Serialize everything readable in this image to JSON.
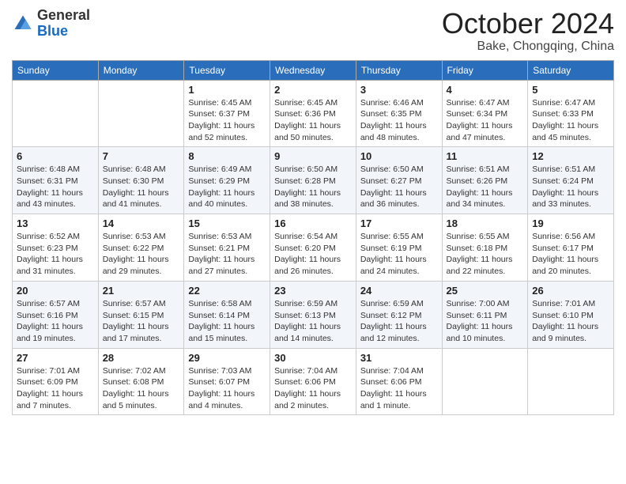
{
  "logo": {
    "general": "General",
    "blue": "Blue"
  },
  "header": {
    "title": "October 2024",
    "location": "Bake, Chongqing, China"
  },
  "weekdays": [
    "Sunday",
    "Monday",
    "Tuesday",
    "Wednesday",
    "Thursday",
    "Friday",
    "Saturday"
  ],
  "weeks": [
    [
      {
        "day": "",
        "info": ""
      },
      {
        "day": "",
        "info": ""
      },
      {
        "day": "1",
        "info": "Sunrise: 6:45 AM\nSunset: 6:37 PM\nDaylight: 11 hours and 52 minutes."
      },
      {
        "day": "2",
        "info": "Sunrise: 6:45 AM\nSunset: 6:36 PM\nDaylight: 11 hours and 50 minutes."
      },
      {
        "day": "3",
        "info": "Sunrise: 6:46 AM\nSunset: 6:35 PM\nDaylight: 11 hours and 48 minutes."
      },
      {
        "day": "4",
        "info": "Sunrise: 6:47 AM\nSunset: 6:34 PM\nDaylight: 11 hours and 47 minutes."
      },
      {
        "day": "5",
        "info": "Sunrise: 6:47 AM\nSunset: 6:33 PM\nDaylight: 11 hours and 45 minutes."
      }
    ],
    [
      {
        "day": "6",
        "info": "Sunrise: 6:48 AM\nSunset: 6:31 PM\nDaylight: 11 hours and 43 minutes."
      },
      {
        "day": "7",
        "info": "Sunrise: 6:48 AM\nSunset: 6:30 PM\nDaylight: 11 hours and 41 minutes."
      },
      {
        "day": "8",
        "info": "Sunrise: 6:49 AM\nSunset: 6:29 PM\nDaylight: 11 hours and 40 minutes."
      },
      {
        "day": "9",
        "info": "Sunrise: 6:50 AM\nSunset: 6:28 PM\nDaylight: 11 hours and 38 minutes."
      },
      {
        "day": "10",
        "info": "Sunrise: 6:50 AM\nSunset: 6:27 PM\nDaylight: 11 hours and 36 minutes."
      },
      {
        "day": "11",
        "info": "Sunrise: 6:51 AM\nSunset: 6:26 PM\nDaylight: 11 hours and 34 minutes."
      },
      {
        "day": "12",
        "info": "Sunrise: 6:51 AM\nSunset: 6:24 PM\nDaylight: 11 hours and 33 minutes."
      }
    ],
    [
      {
        "day": "13",
        "info": "Sunrise: 6:52 AM\nSunset: 6:23 PM\nDaylight: 11 hours and 31 minutes."
      },
      {
        "day": "14",
        "info": "Sunrise: 6:53 AM\nSunset: 6:22 PM\nDaylight: 11 hours and 29 minutes."
      },
      {
        "day": "15",
        "info": "Sunrise: 6:53 AM\nSunset: 6:21 PM\nDaylight: 11 hours and 27 minutes."
      },
      {
        "day": "16",
        "info": "Sunrise: 6:54 AM\nSunset: 6:20 PM\nDaylight: 11 hours and 26 minutes."
      },
      {
        "day": "17",
        "info": "Sunrise: 6:55 AM\nSunset: 6:19 PM\nDaylight: 11 hours and 24 minutes."
      },
      {
        "day": "18",
        "info": "Sunrise: 6:55 AM\nSunset: 6:18 PM\nDaylight: 11 hours and 22 minutes."
      },
      {
        "day": "19",
        "info": "Sunrise: 6:56 AM\nSunset: 6:17 PM\nDaylight: 11 hours and 20 minutes."
      }
    ],
    [
      {
        "day": "20",
        "info": "Sunrise: 6:57 AM\nSunset: 6:16 PM\nDaylight: 11 hours and 19 minutes."
      },
      {
        "day": "21",
        "info": "Sunrise: 6:57 AM\nSunset: 6:15 PM\nDaylight: 11 hours and 17 minutes."
      },
      {
        "day": "22",
        "info": "Sunrise: 6:58 AM\nSunset: 6:14 PM\nDaylight: 11 hours and 15 minutes."
      },
      {
        "day": "23",
        "info": "Sunrise: 6:59 AM\nSunset: 6:13 PM\nDaylight: 11 hours and 14 minutes."
      },
      {
        "day": "24",
        "info": "Sunrise: 6:59 AM\nSunset: 6:12 PM\nDaylight: 11 hours and 12 minutes."
      },
      {
        "day": "25",
        "info": "Sunrise: 7:00 AM\nSunset: 6:11 PM\nDaylight: 11 hours and 10 minutes."
      },
      {
        "day": "26",
        "info": "Sunrise: 7:01 AM\nSunset: 6:10 PM\nDaylight: 11 hours and 9 minutes."
      }
    ],
    [
      {
        "day": "27",
        "info": "Sunrise: 7:01 AM\nSunset: 6:09 PM\nDaylight: 11 hours and 7 minutes."
      },
      {
        "day": "28",
        "info": "Sunrise: 7:02 AM\nSunset: 6:08 PM\nDaylight: 11 hours and 5 minutes."
      },
      {
        "day": "29",
        "info": "Sunrise: 7:03 AM\nSunset: 6:07 PM\nDaylight: 11 hours and 4 minutes."
      },
      {
        "day": "30",
        "info": "Sunrise: 7:04 AM\nSunset: 6:06 PM\nDaylight: 11 hours and 2 minutes."
      },
      {
        "day": "31",
        "info": "Sunrise: 7:04 AM\nSunset: 6:06 PM\nDaylight: 11 hours and 1 minute."
      },
      {
        "day": "",
        "info": ""
      },
      {
        "day": "",
        "info": ""
      }
    ]
  ]
}
